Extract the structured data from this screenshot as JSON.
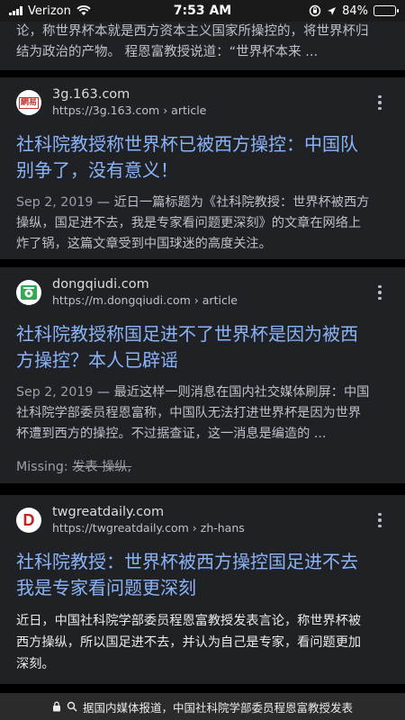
{
  "status": {
    "carrier": "Verizon",
    "time": "7:53 AM",
    "battery": "84%",
    "battery_level": 0.84
  },
  "top_snippet": {
    "line1": "论，称世界杯本就是西方资本主义国家所操控的，将世界杯归",
    "line2": "结为政治的产物。 程恩富教授说道：“世界杯本来 ..."
  },
  "results": [
    {
      "domain": "3g.163.com",
      "url": "https://3g.163.com",
      "path": "› article",
      "favicon_label": "網易",
      "favicon_color": "#c4302b",
      "title_line1": "社科院教授称世界杯已被西方操控：中国队",
      "title_line2": "别争了，没有意义！",
      "date": "Sep 2, 2019",
      "snippet_lead": " — 近日一篇标题为《社科院教授：世界杯被西方",
      "snippet_line2": "操纵，国足进不去，我是专家看问题更深刻》的文章在网络上",
      "snippet_line3": "炸了锅，这篇文章受到中国球迷的高度关注。"
    },
    {
      "domain": "dongqiudi.com",
      "url": "https://m.dongqiudi.com",
      "path": "› article",
      "favicon_color": "#34a853",
      "title_line1": "社科院教授称国足进不了世界杯是因为被西",
      "title_line2": "方操控？本人已辟谣",
      "date": "Sep 2, 2019",
      "snippet_lead": " — 最近这样一则消息在国内社交媒体刷屏：中国",
      "snippet_line2": "社科院学部委员程恩富称，中国队无法打进世界杯是因为世界",
      "snippet_line3": "杯遭到西方的操控。不过据查证，这一消息是编造的 ...",
      "missing_label": "Missing:",
      "missing_terms": "发表 操纵,"
    },
    {
      "domain": "twgreatdaily.com",
      "url": "https://twgreatdaily.com",
      "path": "› zh-hans",
      "favicon_label": "D",
      "favicon_color": "#c5221f",
      "title_line1": "社科院教授：世界杯被西方操控国足进不去",
      "title_line2": "我是专家看问题更深刻",
      "snippet_line1": "近日，中国社科院学部委员程恩富教授发表言论，称世界杯被",
      "snippet_line2": "西方操纵，所以国足进不去，并认为自己是专家，看问题更加",
      "snippet_line3": "深刻。"
    }
  ],
  "bottom_bar": {
    "text": "据国内媒体报道，中国社科院学部委员程恩富教授发表"
  }
}
